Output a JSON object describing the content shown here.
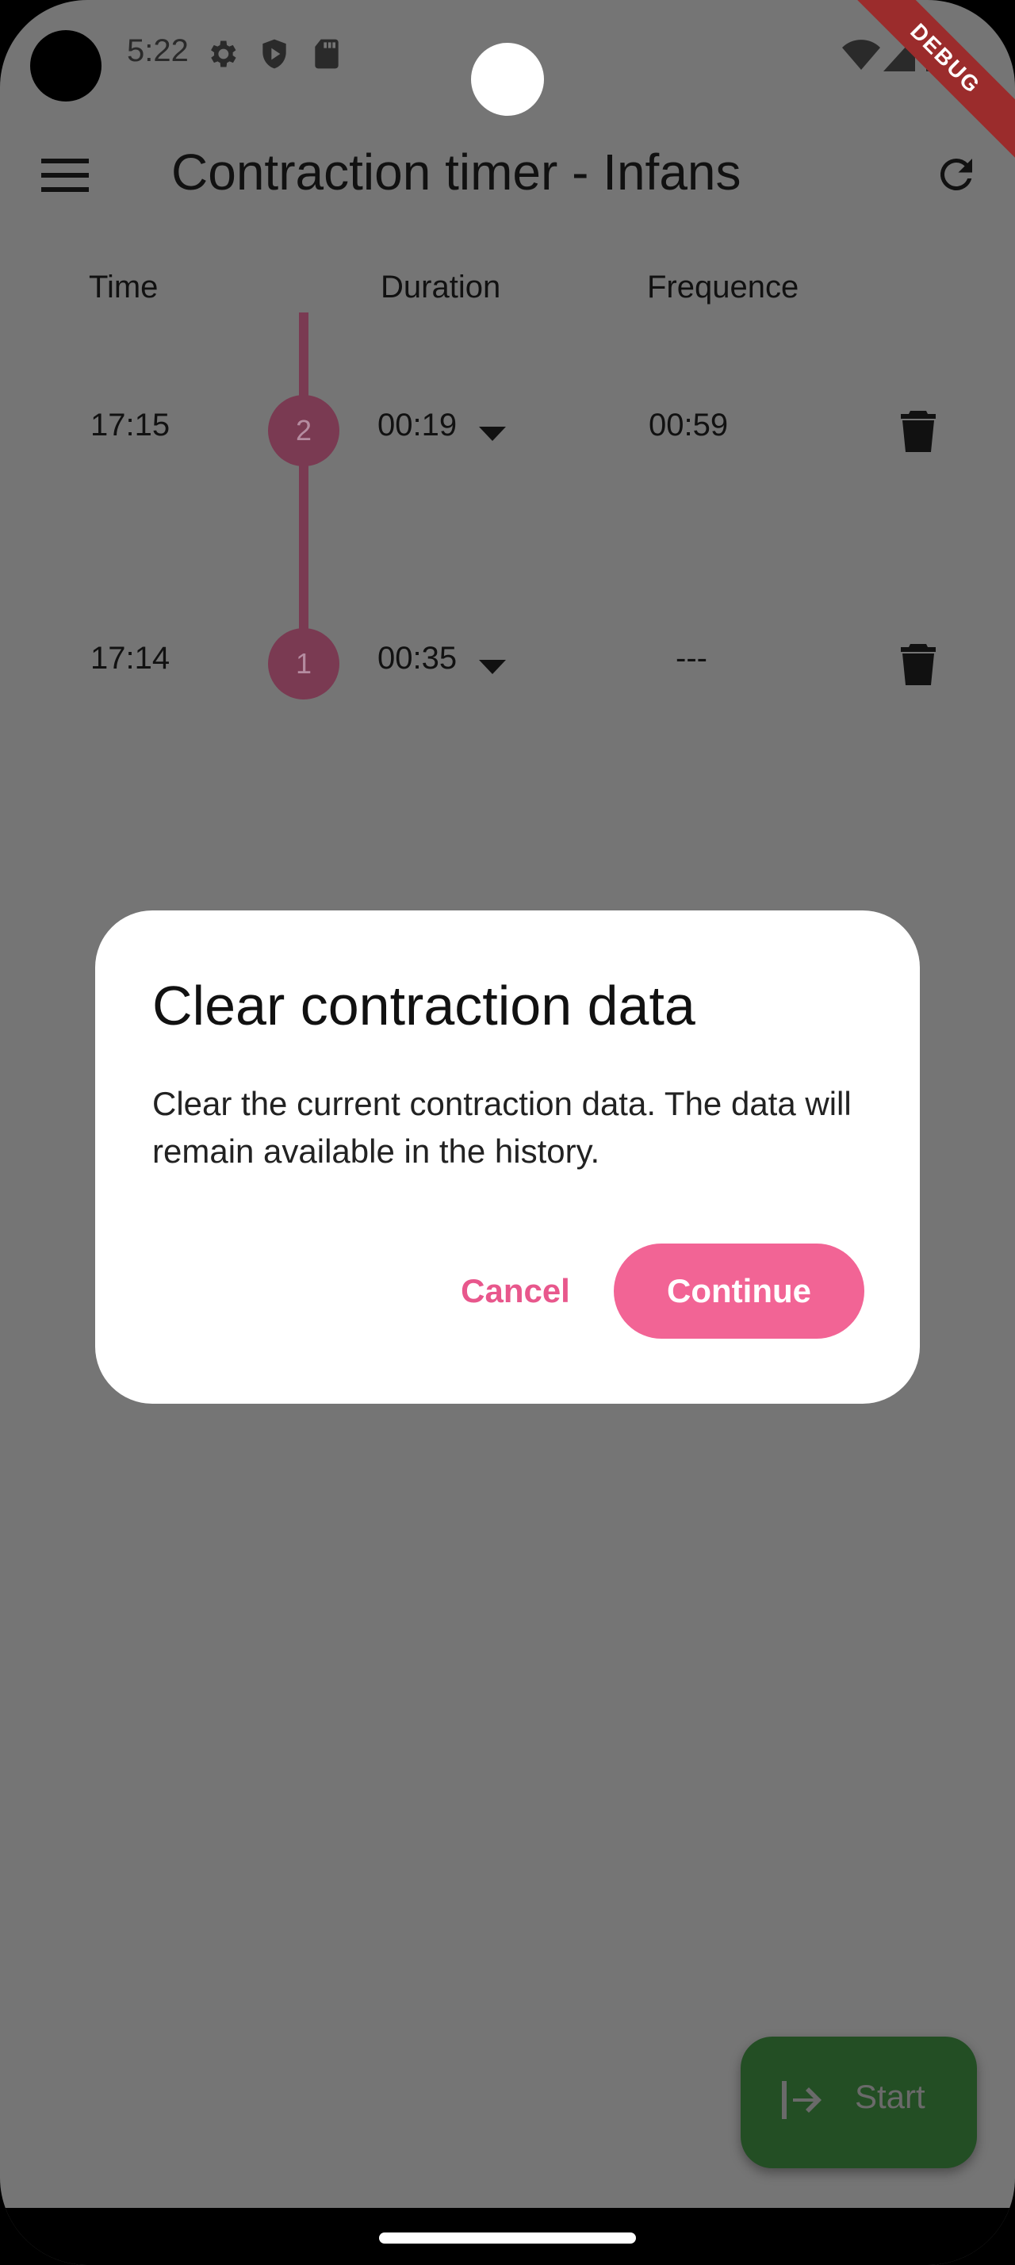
{
  "status_bar": {
    "time": "5:22"
  },
  "debug_banner": "DEBUG",
  "app_bar": {
    "title": "Contraction timer - Infans"
  },
  "table": {
    "headers": [
      "Time",
      "Duration",
      "Frequence"
    ],
    "rows": [
      {
        "time": "17:15",
        "index": "2",
        "duration": "00:19",
        "frequency": "00:59"
      },
      {
        "time": "17:14",
        "index": "1",
        "duration": "00:35",
        "frequency": "---"
      }
    ]
  },
  "dialog": {
    "title": "Clear contraction data",
    "body": "Clear the current contraction data. The data will remain available in the history.",
    "cancel_label": "Cancel",
    "continue_label": "Continue"
  },
  "fab": {
    "label": "Start"
  },
  "colors": {
    "scrim": "#757575",
    "accent": "#f26495",
    "badge": "#7a3a52",
    "fab": "#234e24"
  }
}
